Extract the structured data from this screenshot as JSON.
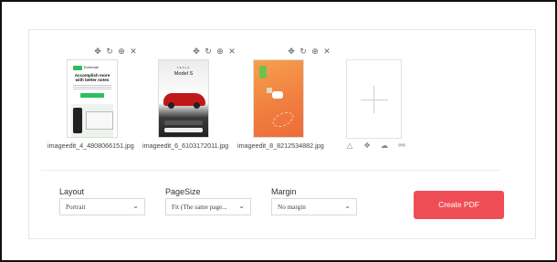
{
  "thumbnails": [
    {
      "filename": "imageedit_4_4808066151.jpg",
      "preview": {
        "brand": "Evernote",
        "heading": "Accomplish more with better notes"
      }
    },
    {
      "filename": "imageedit_6_6103172011.jpg",
      "preview": {
        "brand": "TESLA",
        "heading": "Model S"
      }
    },
    {
      "filename": "imageedit_8_8212534882.jpg",
      "preview": {}
    }
  ],
  "tool_icons": [
    "move-icon",
    "rotate-icon",
    "zoom-in-icon",
    "close-icon"
  ],
  "tool_glyphs": [
    "✥",
    "↻",
    "⊕",
    "✕"
  ],
  "source_icons": [
    {
      "name": "google-drive-icon",
      "glyph": "△"
    },
    {
      "name": "dropbox-icon",
      "glyph": "❖"
    },
    {
      "name": "onedrive-icon",
      "glyph": "☁"
    },
    {
      "name": "link-icon",
      "glyph": "⚯"
    }
  ],
  "options": {
    "layout": {
      "label": "Layout",
      "value": "Portrait"
    },
    "page_size": {
      "label": "PageSize",
      "value": "Fit (The same page..."
    },
    "margin": {
      "label": "Margin",
      "value": "No margin"
    }
  },
  "create_button": {
    "label": "Create PDF"
  },
  "colors": {
    "accent": "#ef4d56",
    "border": "#e6e6e6"
  }
}
